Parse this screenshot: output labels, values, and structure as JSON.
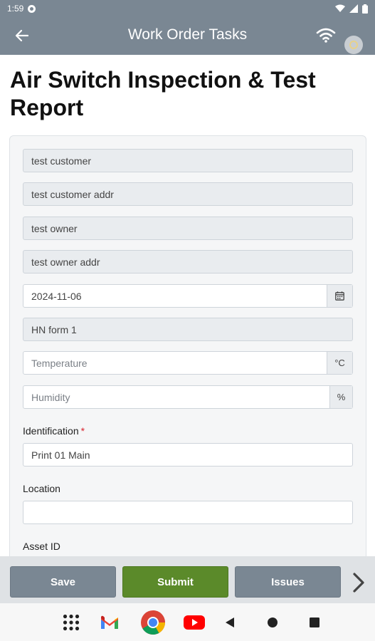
{
  "status_bar": {
    "time": "1:59"
  },
  "app_bar": {
    "title": "Work Order Tasks"
  },
  "page": {
    "title": "Air Switch Inspection & Test Report"
  },
  "form": {
    "customer": "test customer",
    "customer_addr": "test customer addr",
    "owner": "test owner",
    "owner_addr": "test owner addr",
    "date": "2024-11-06",
    "form_name": "HN form 1",
    "temperature": {
      "placeholder": "Temperature",
      "unit": "°C"
    },
    "humidity": {
      "placeholder": "Humidity",
      "unit": "%"
    },
    "identification": {
      "label": "Identification",
      "required_mark": "*",
      "value": "Print 01 Main"
    },
    "location": {
      "label": "Location",
      "value": ""
    },
    "asset_id": {
      "label": "Asset ID"
    }
  },
  "actions": {
    "save": "Save",
    "submit": "Submit",
    "issues": "Issues"
  },
  "colors": {
    "app_bar": "#7a8793",
    "submit_green": "#5b8a2a",
    "required_red": "#d9232e"
  },
  "icons": {
    "back": "arrow-left-icon",
    "wifi": "wifi-icon",
    "sync": "sync-status-icon",
    "calendar": "calendar-icon",
    "next": "chevron-right-icon",
    "nav": [
      "apps-grid-icon",
      "gmail-icon",
      "chrome-icon",
      "youtube-icon",
      "nav-back-icon",
      "nav-home-icon",
      "nav-recents-icon"
    ]
  }
}
